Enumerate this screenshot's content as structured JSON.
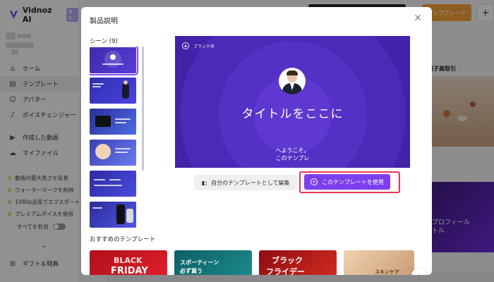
{
  "app": {
    "logo_text": "Vidnoz AI",
    "logo_badge": "無料",
    "nav": [
      {
        "label": "ホーム",
        "icon": "home-icon"
      },
      {
        "label": "テンプレート",
        "icon": "template-icon"
      },
      {
        "label": "アバター",
        "icon": "avatar-icon"
      },
      {
        "label": "ボイスチェンジャー",
        "icon": "voice-icon"
      },
      {
        "label": "作成した動画",
        "icon": "video-icon"
      },
      {
        "label": "マイファイル",
        "icon": "cloud-icon"
      }
    ],
    "perks": [
      "動画の最大長さを延長",
      "ウォーターマークを削除",
      "1080p品質でエクスポート",
      "プレミアムボイスを使用"
    ],
    "enable_all": "すべてを有効",
    "gift": "ギフト＆特典",
    "upgrade": "アップグレード",
    "right_heading": "電子商取引",
    "right_banner_line1": "プロフィール",
    "right_banner_line2": "トル"
  },
  "modal": {
    "title": "製品説明",
    "scene_label": "シーン (9)",
    "preview": {
      "brand": "ブランド名",
      "title": "タイトルをここに",
      "sub_line1": "へようこそ。",
      "sub_line2": "このテンプレ"
    },
    "edit_button": "自分のテンプレートとして編集",
    "use_button": "このテンプレートを使用",
    "rec_label": "おすすめのテンプレート",
    "rec_cards": [
      {
        "line1": "BLACK",
        "line2": "FRIDAY"
      },
      {
        "line1": "スポーティーン",
        "line2": "必ず買う"
      },
      {
        "line1": "ブラック",
        "line2": "フライデー"
      },
      {
        "line1": "",
        "line2": ""
      },
      {
        "line1": "スキンケア",
        "line2": ""
      }
    ]
  },
  "colors": {
    "accent": "#7c3fef",
    "highlight": "#e8335a",
    "preview_bg": "#3a1f9c"
  }
}
